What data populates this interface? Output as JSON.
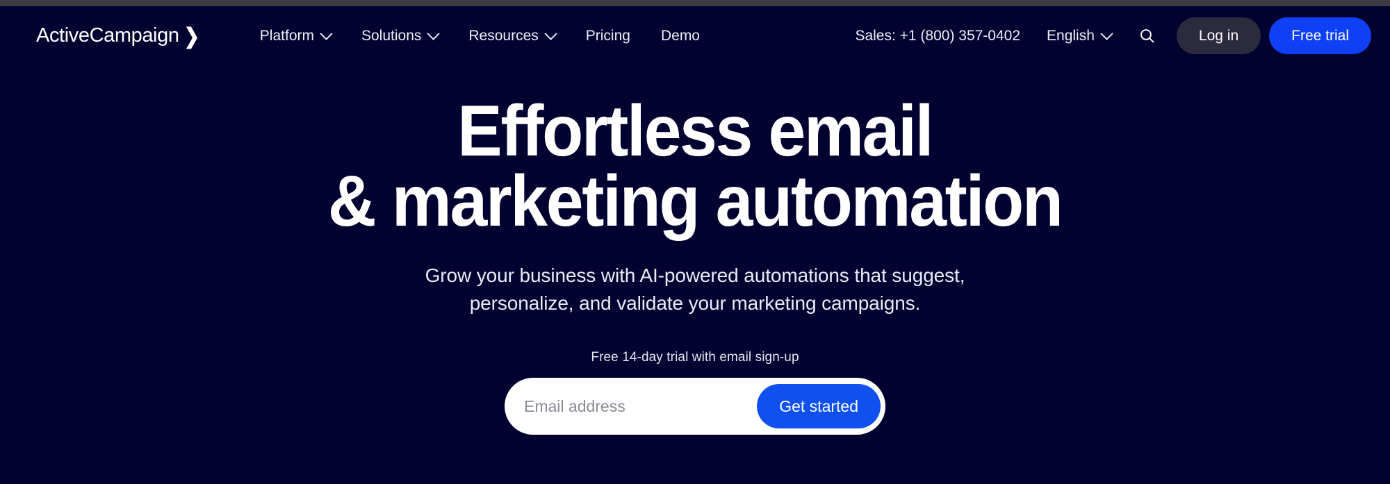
{
  "brand": {
    "name": "ActiveCampaign",
    "mark": "❯",
    "accent_blue": "#0f40f5",
    "background": "#010230",
    "top_chrome": "#3c3c41"
  },
  "nav": {
    "links": [
      {
        "label": "Platform",
        "has_dropdown": true
      },
      {
        "label": "Solutions",
        "has_dropdown": true
      },
      {
        "label": "Resources",
        "has_dropdown": true
      },
      {
        "label": "Pricing",
        "has_dropdown": false
      },
      {
        "label": "Demo",
        "has_dropdown": false
      }
    ],
    "sales_phone": "Sales: +1 (800) 357-0402",
    "language": "English",
    "search_icon": "search-icon",
    "login_label": "Log in",
    "trial_label": "Free trial"
  },
  "hero": {
    "headline_line1": "Effortless email",
    "headline_line2": "& marketing automation",
    "subhead_line1": "Grow your business with AI-powered automations that suggest,",
    "subhead_line2": "personalize, and validate your marketing campaigns.",
    "trial_note": "Free 14-day trial with email sign-up",
    "email_placeholder": "Email address",
    "email_value": "",
    "cta_label": "Get started"
  }
}
